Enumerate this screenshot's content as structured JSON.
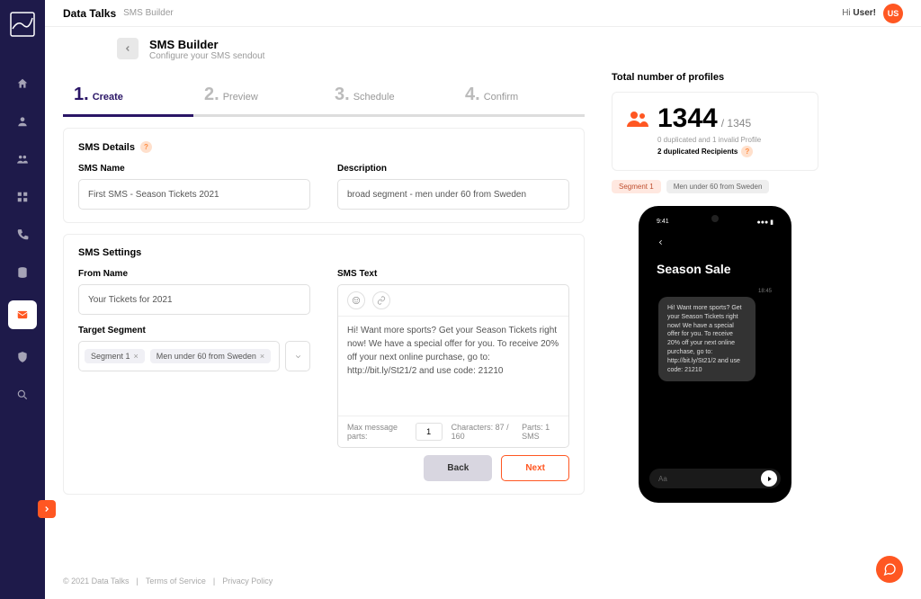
{
  "brand": "Data Talks",
  "breadcrumb": "SMS Builder",
  "greeting_prefix": "Hi ",
  "greeting_user": "User!",
  "avatar": "US",
  "header": {
    "title": "SMS Builder",
    "subtitle": "Configure your SMS sendout"
  },
  "steps": [
    {
      "num": "1.",
      "label": "Create",
      "active": true
    },
    {
      "num": "2.",
      "label": "Preview"
    },
    {
      "num": "3.",
      "label": "Schedule"
    },
    {
      "num": "4.",
      "label": "Confirm"
    }
  ],
  "details": {
    "title": "SMS Details",
    "name_label": "SMS Name",
    "name_value": "First SMS - Season Tickets 2021",
    "desc_label": "Description",
    "desc_value": "broad segment - men under 60 from Sweden"
  },
  "settings": {
    "title": "SMS Settings",
    "from_label": "From Name",
    "from_value": "Your Tickets for 2021",
    "target_label": "Target Segment",
    "tags": [
      "Segment 1",
      "Men under 60 from Sweden"
    ],
    "text_label": "SMS Text",
    "text_body": "Hi! Want more sports? Get your Season Tickets right now! We have a special offer for you. To receive 20% off your next online purchase, go to:  http://bit.ly/St21/2 and use code: 21210",
    "max_parts_label": "Max message parts:",
    "max_parts_value": "1",
    "chars": "Characters: 87 / 160",
    "parts": "Parts: 1 SMS"
  },
  "buttons": {
    "back": "Back",
    "next": "Next"
  },
  "profiles": {
    "title": "Total number of profiles",
    "count": "1344",
    "total": "/ 1345",
    "dup": "0 duplicated and 1 invalid Profile",
    "dup_rec": "2 duplicated Recipients",
    "pills": [
      "Segment 1",
      "Men under 60 from Sweden"
    ]
  },
  "phone": {
    "time": "9:41",
    "title": "Season Sale",
    "msg_time": "18:45",
    "msg": "Hi! Want more sports? Get your Season Tickets right now! We have a special offer for you. To receive 20% off your next online purchase, go to: http://bit.ly/St21/2 and use code: 21210",
    "input_placeholder": "Aa"
  },
  "footer": {
    "copyright": "© 2021 Data Talks",
    "terms": "Terms of Service",
    "privacy": "Privacy Policy"
  }
}
